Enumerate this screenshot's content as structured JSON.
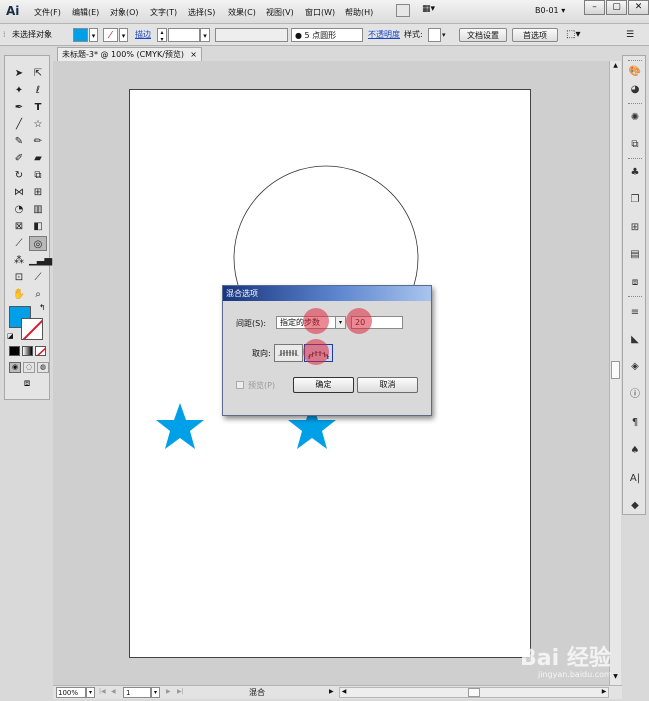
{
  "menubar": {
    "logo": "Ai",
    "items": [
      "文件(F)",
      "编辑(E)",
      "对象(O)",
      "文字(T)",
      "选择(S)",
      "效果(C)",
      "视图(V)",
      "窗口(W)",
      "帮助(H)"
    ],
    "workspace": "B0-01"
  },
  "control": {
    "selection": "未选择对象",
    "stroke_label": "描边",
    "brush": "5 点圆形",
    "opacity_label": "不透明度",
    "style_label": "样式:",
    "doc_setup": "文档设置",
    "prefs": "首选项",
    "fill_color": "#00a0e9"
  },
  "doc_tab": {
    "title": "未标题-3* @ 100% (CMYK/预览)",
    "close": "×"
  },
  "canvas": {
    "star_color": "#00a0e9"
  },
  "dialog": {
    "title": "混合选项",
    "spacing_label": "间距(S):",
    "spacing_option": "指定的步数",
    "spacing_value": "20",
    "orient_label": "取向:",
    "preview_label": "预览(P)",
    "ok": "确定",
    "cancel": "取消"
  },
  "status": {
    "zoom": "100%",
    "page": "1",
    "tool": "混合"
  },
  "watermark": {
    "brand": "Bai 经验",
    "url": "jingyan.baidu.com"
  }
}
